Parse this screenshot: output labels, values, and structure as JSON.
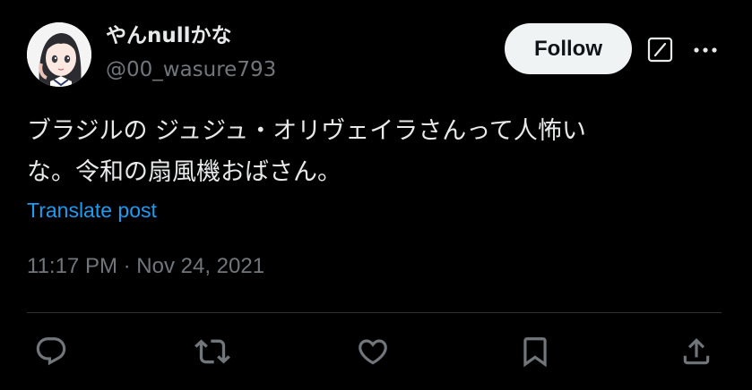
{
  "user": {
    "display_name": "やんnullかな",
    "handle": "@00_wasure793",
    "avatar_icon": "anime-girl-avatar"
  },
  "header": {
    "follow_label": "Follow",
    "grok_icon": "grok-icon",
    "more_icon": "more-options-icon"
  },
  "tweet": {
    "text_line1": "ブラジルの ジュジュ・オリヴェイラさんって人怖い",
    "text_line2": "な。令和の扇風機おばさん。",
    "translate_label": "Translate post",
    "timestamp": "11:17 PM · Nov 24, 2021"
  },
  "actions": [
    {
      "icon": "reply-icon"
    },
    {
      "icon": "retweet-icon"
    },
    {
      "icon": "like-icon"
    },
    {
      "icon": "bookmark-icon"
    },
    {
      "icon": "share-icon"
    }
  ],
  "colors": {
    "background": "#000000",
    "primary_text": "#e7e9ea",
    "secondary_text": "#71767b",
    "link": "#1d9bf0",
    "button_bg": "#eff3f4",
    "divider": "#2f3336"
  }
}
